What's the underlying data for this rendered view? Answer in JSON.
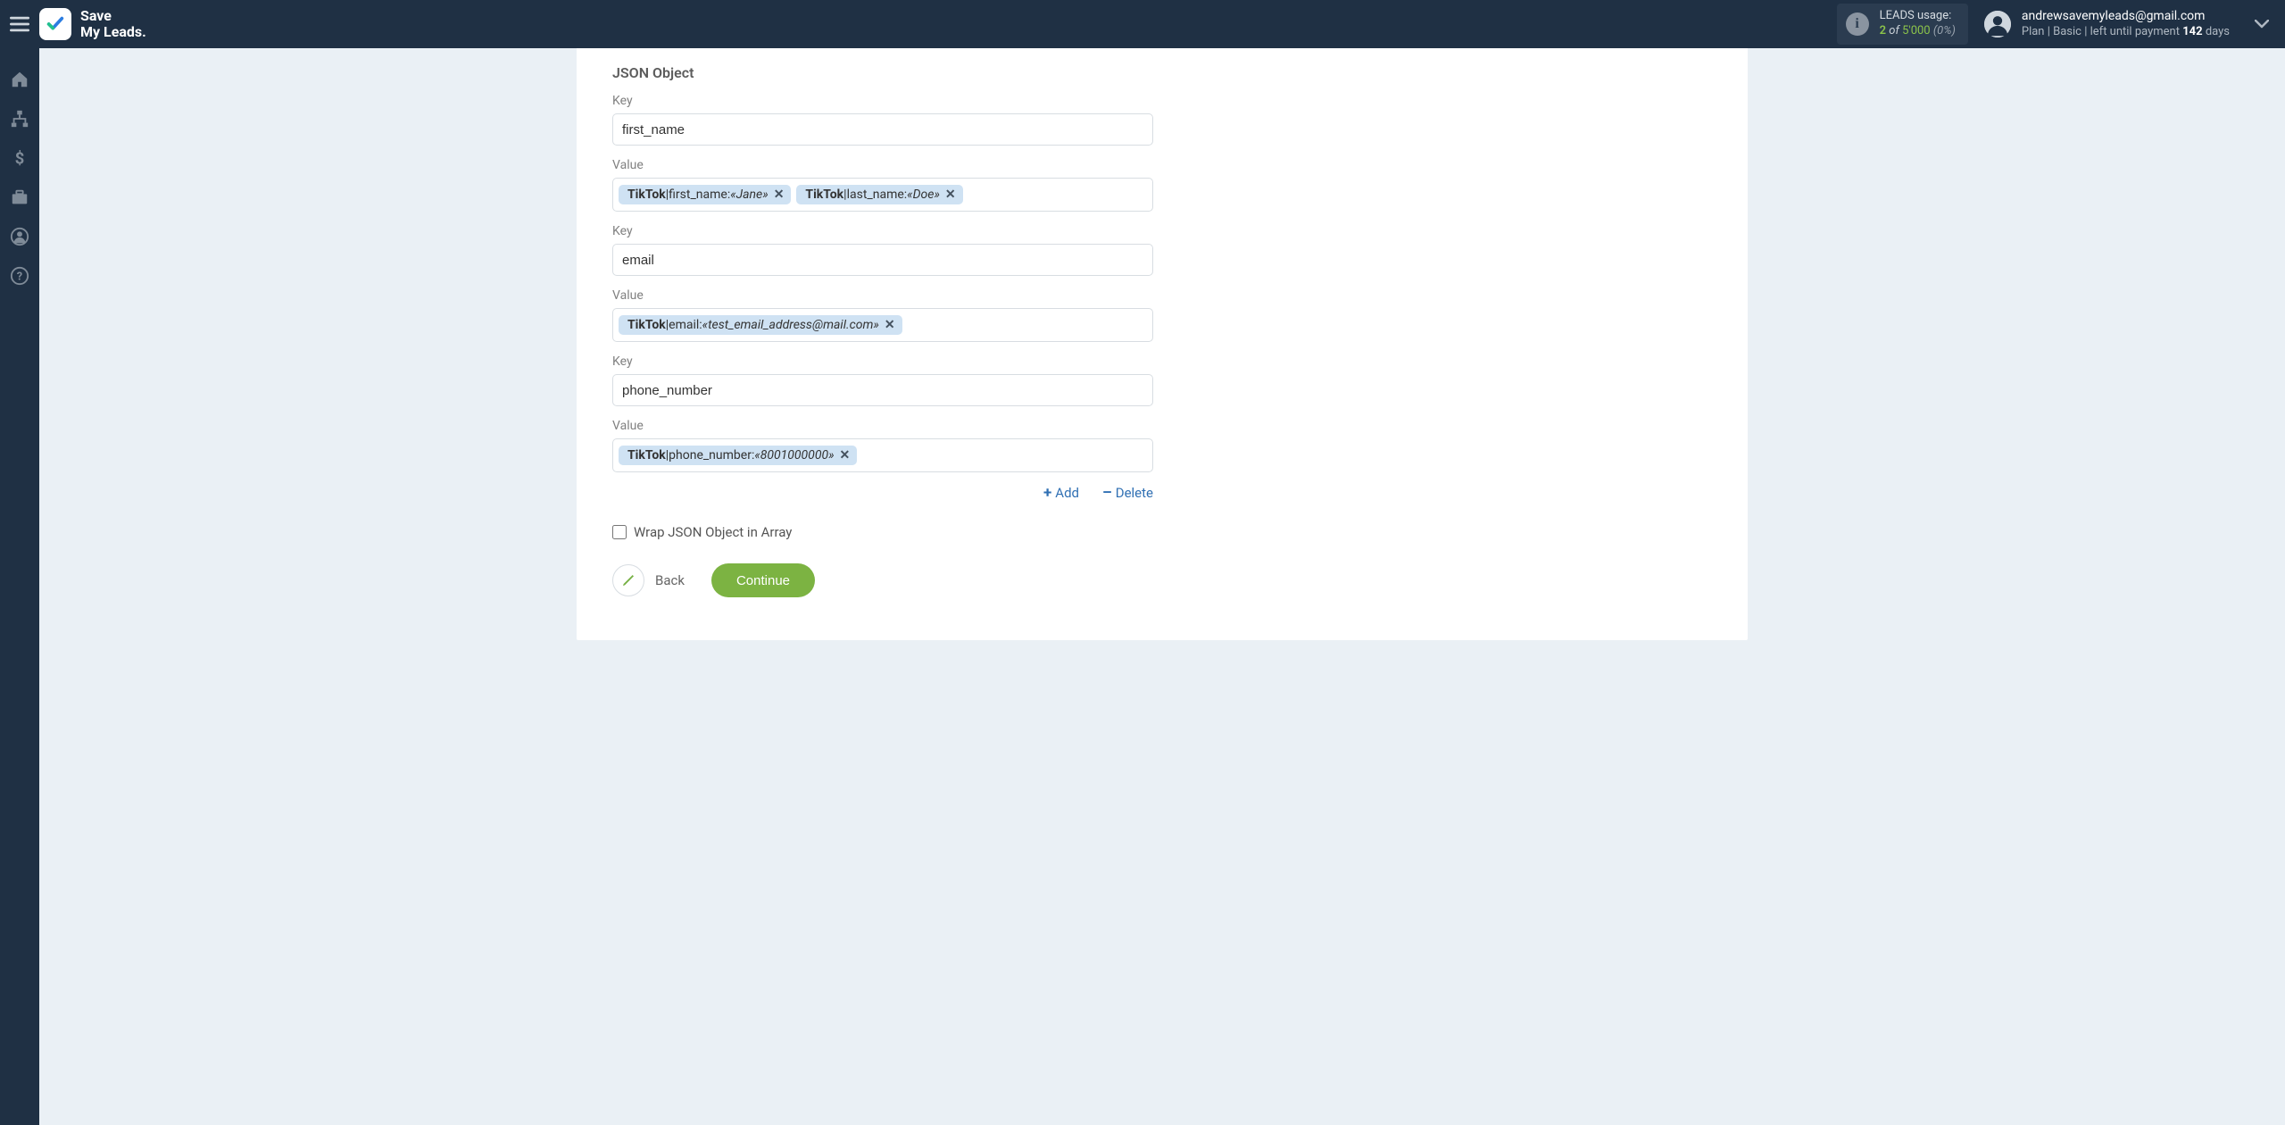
{
  "brand": {
    "line1": "Save",
    "line2": "My Leads."
  },
  "header": {
    "leads_label": "LEADS usage:",
    "leads_used": "2",
    "leads_of": "of",
    "leads_total": "5'000",
    "leads_pct": "(0%)",
    "email": "andrewsavemyleads@gmail.com",
    "plan_prefix": "Plan |",
    "plan_name": "Basic",
    "plan_mid": "| left until payment",
    "plan_days": "142",
    "plan_days_suffix": "days"
  },
  "sidebar_icons": [
    "home",
    "sitemap",
    "dollar",
    "briefcase",
    "user",
    "help"
  ],
  "section": {
    "title": "JSON Object",
    "key_label": "Key",
    "value_label": "Value",
    "rows": [
      {
        "key": "first_name",
        "tags": [
          {
            "source": "TikTok",
            "field": "first_name",
            "value": "«Jane»"
          },
          {
            "source": "TikTok",
            "field": "last_name",
            "value": "«Doe»"
          }
        ]
      },
      {
        "key": "email",
        "tags": [
          {
            "source": "TikTok",
            "field": "email",
            "value": "«test_email_address@mail.com»"
          }
        ]
      },
      {
        "key": "phone_number",
        "tags": [
          {
            "source": "TikTok",
            "field": "phone_number",
            "value": "«8001000000»"
          }
        ]
      }
    ],
    "add_label": "Add",
    "delete_label": "Delete",
    "wrap_label": "Wrap JSON Object in Array",
    "back_label": "Back",
    "continue_label": "Continue"
  }
}
